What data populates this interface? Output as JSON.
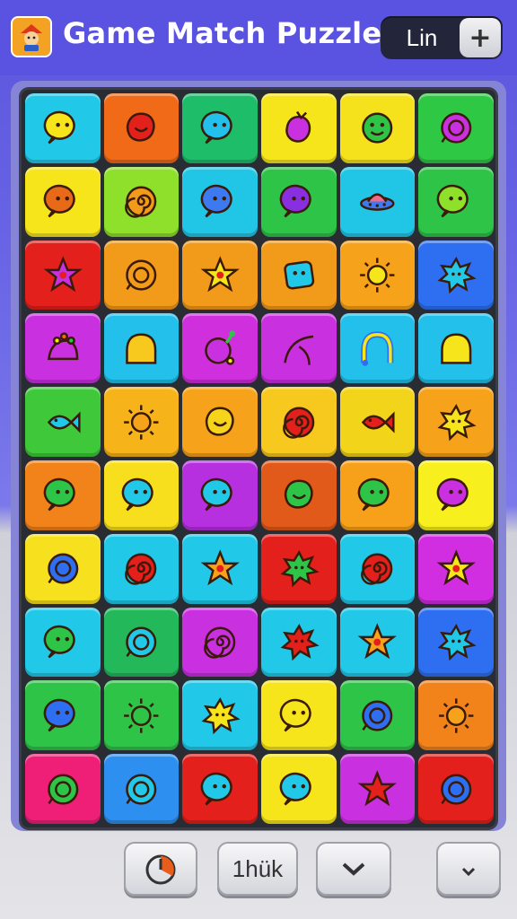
{
  "header": {
    "title": "Game Match Puzzle",
    "user_label": "Lin",
    "plus_label": "+"
  },
  "controls": {
    "hint_label": "1hük"
  },
  "board": {
    "rows": 10,
    "cols": 6,
    "tiles": [
      [
        "#22c8e8",
        "#f06a18",
        "#1dbd6a",
        "#f7e51c",
        "#f5e21d",
        "#2fc844"
      ],
      [
        "#f7e51c",
        "#8ee02a",
        "#21c6e6",
        "#2ec448",
        "#21c6e6",
        "#2ec448"
      ],
      [
        "#e3201c",
        "#f29a1a",
        "#f29a1a",
        "#f29a1a",
        "#f6a21a",
        "#2d6ff0"
      ],
      [
        "#c930e0",
        "#22c0ea",
        "#cf2fdc",
        "#c930e0",
        "#22c0ea",
        "#22c0ea"
      ],
      [
        "#3ec83a",
        "#f6b41a",
        "#f6a21a",
        "#f7c91e",
        "#f2d41a",
        "#f6a21a"
      ],
      [
        "#f2821a",
        "#f7df1e",
        "#b630e0",
        "#e25a1a",
        "#f7a01a",
        "#f7f01e"
      ],
      [
        "#f7e11e",
        "#22c8e8",
        "#22c8e8",
        "#e3201c",
        "#22c8e8",
        "#d02ee0"
      ],
      [
        "#22c8e8",
        "#23b85a",
        "#c930e0",
        "#22c8e8",
        "#22c8e8",
        "#2d6ff0"
      ],
      [
        "#2ec448",
        "#2ec448",
        "#22c8e8",
        "#f7e51c",
        "#2ec448",
        "#f2821a"
      ],
      [
        "#ef1f78",
        "#2d8ff0",
        "#e3201c",
        "#f7e51c",
        "#c930e0",
        "#e3201c"
      ]
    ],
    "icons": [
      [
        "bubble-icon",
        "blob-icon",
        "bubble-icon",
        "berry-icon",
        "smiley-icon",
        "ring-icon"
      ],
      [
        "bubble-icon",
        "spiral-icon",
        "bubble-icon",
        "bubble-icon",
        "ufo-icon",
        "bubble-icon"
      ],
      [
        "star-icon",
        "ring-icon",
        "star-icon",
        "square-icon",
        "sun-icon",
        "splat-icon"
      ],
      [
        "dots-icon",
        "dome-icon",
        "fruit-icon",
        "swoosh-icon",
        "arch-icon",
        "dome-icon"
      ],
      [
        "fish-icon",
        "sun-icon",
        "blob-icon",
        "spiral-icon",
        "fish-icon",
        "splat-icon"
      ],
      [
        "bubble-icon",
        "bubble-icon",
        "bubble-icon",
        "blob-icon",
        "bubble-icon",
        "bubble-icon"
      ],
      [
        "ring-icon",
        "spiral-icon",
        "star-icon",
        "splat-icon",
        "spiral-icon",
        "star-icon"
      ],
      [
        "bubble-icon",
        "ring-icon",
        "spiral-icon",
        "splat-icon",
        "star-icon",
        "splat-icon"
      ],
      [
        "bubble-icon",
        "sun-icon",
        "splat-icon",
        "bubble-icon",
        "ring-icon",
        "sun-icon"
      ],
      [
        "ring-icon",
        "ring-icon",
        "bubble-icon",
        "bubble-icon",
        "star-icon",
        "ring-icon"
      ]
    ],
    "icon_colors": [
      [
        "#f7e51c",
        "#e3201c",
        "#22c0ea",
        "#c930e0",
        "#2ec448",
        "#c930e0"
      ],
      [
        "#e86a18",
        "#f29a1a",
        "#3d7af0",
        "#8a2fe0",
        "#3d7af0",
        "#8ee02a"
      ],
      [
        "#c930e0",
        "#f29a1a",
        "#f7e51c",
        "#22c8e8",
        "#f7e51c",
        "#22c8e8"
      ],
      [
        "#c930e0",
        "#f7c91e",
        "#c930e0",
        "#c930e0",
        "#f7e51c",
        "#f7e51c"
      ],
      [
        "#22c8e8",
        "#f6a21a",
        "#f6d41a",
        "#e3201c",
        "#e3201c",
        "#f7e51c"
      ],
      [
        "#2ec448",
        "#22c8e8",
        "#22c8e8",
        "#2ec448",
        "#2ec448",
        "#c930e0"
      ],
      [
        "#2d6ff0",
        "#e3201c",
        "#f6a21a",
        "#2ec448",
        "#e3201c",
        "#f7e51c"
      ],
      [
        "#2ec448",
        "#22c8e8",
        "#c930e0",
        "#e3201c",
        "#f6a21a",
        "#22c8e8"
      ],
      [
        "#2d6ff0",
        "#2ec448",
        "#f7e51c",
        "#f7e51c",
        "#2d6ff0",
        "#f6a21a"
      ],
      [
        "#2ec448",
        "#22c8e8",
        "#22c8e8",
        "#22c8e8",
        "#e3201c",
        "#2d6ff0"
      ]
    ]
  }
}
